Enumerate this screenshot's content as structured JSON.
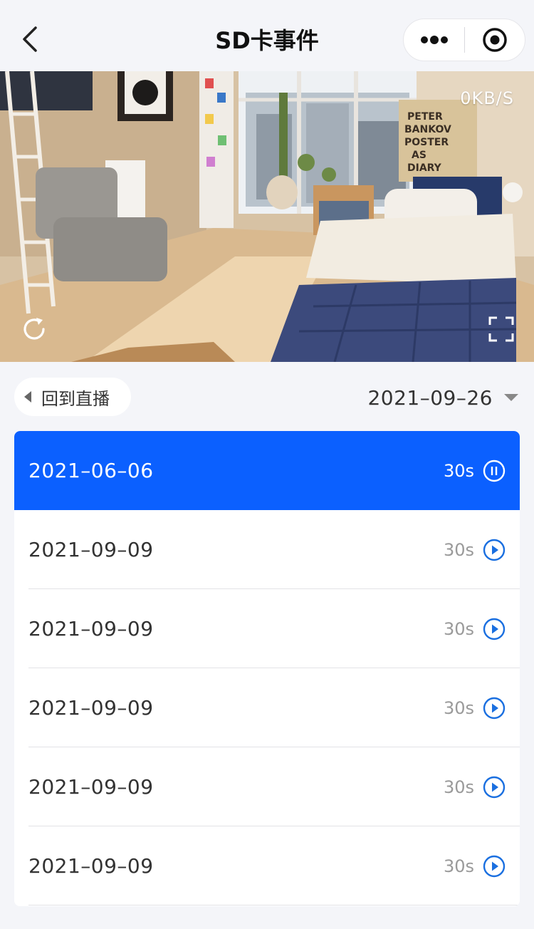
{
  "header": {
    "title": "SD卡事件"
  },
  "video": {
    "speed": "0KB/S",
    "poster": {
      "line1": "PETER",
      "line2": "BANKOV",
      "line3": "POSTER",
      "line4": "AS",
      "line5": "DIARY"
    }
  },
  "controls": {
    "back_live_label": "回到直播",
    "selected_date": "2021–09–26"
  },
  "events": [
    {
      "date": "2021–06–06",
      "duration": "30s",
      "state": "playing"
    },
    {
      "date": "2021–09–09",
      "duration": "30s",
      "state": "idle"
    },
    {
      "date": "2021–09–09",
      "duration": "30s",
      "state": "idle"
    },
    {
      "date": "2021–09–09",
      "duration": "30s",
      "state": "idle"
    },
    {
      "date": "2021–09–09",
      "duration": "30s",
      "state": "idle"
    },
    {
      "date": "2021–09–09",
      "duration": "30s",
      "state": "idle"
    }
  ],
  "colors": {
    "accent": "#0b60ff",
    "icon_blue": "#1a6fe0",
    "background": "#f4f5f9"
  },
  "icons": {
    "back": "chevron-left-icon",
    "more": "more-dots-icon",
    "close": "target-close-icon",
    "refresh": "refresh-icon",
    "fullscreen": "fullscreen-icon",
    "play": "play-circle-icon",
    "pause": "pause-circle-icon"
  }
}
